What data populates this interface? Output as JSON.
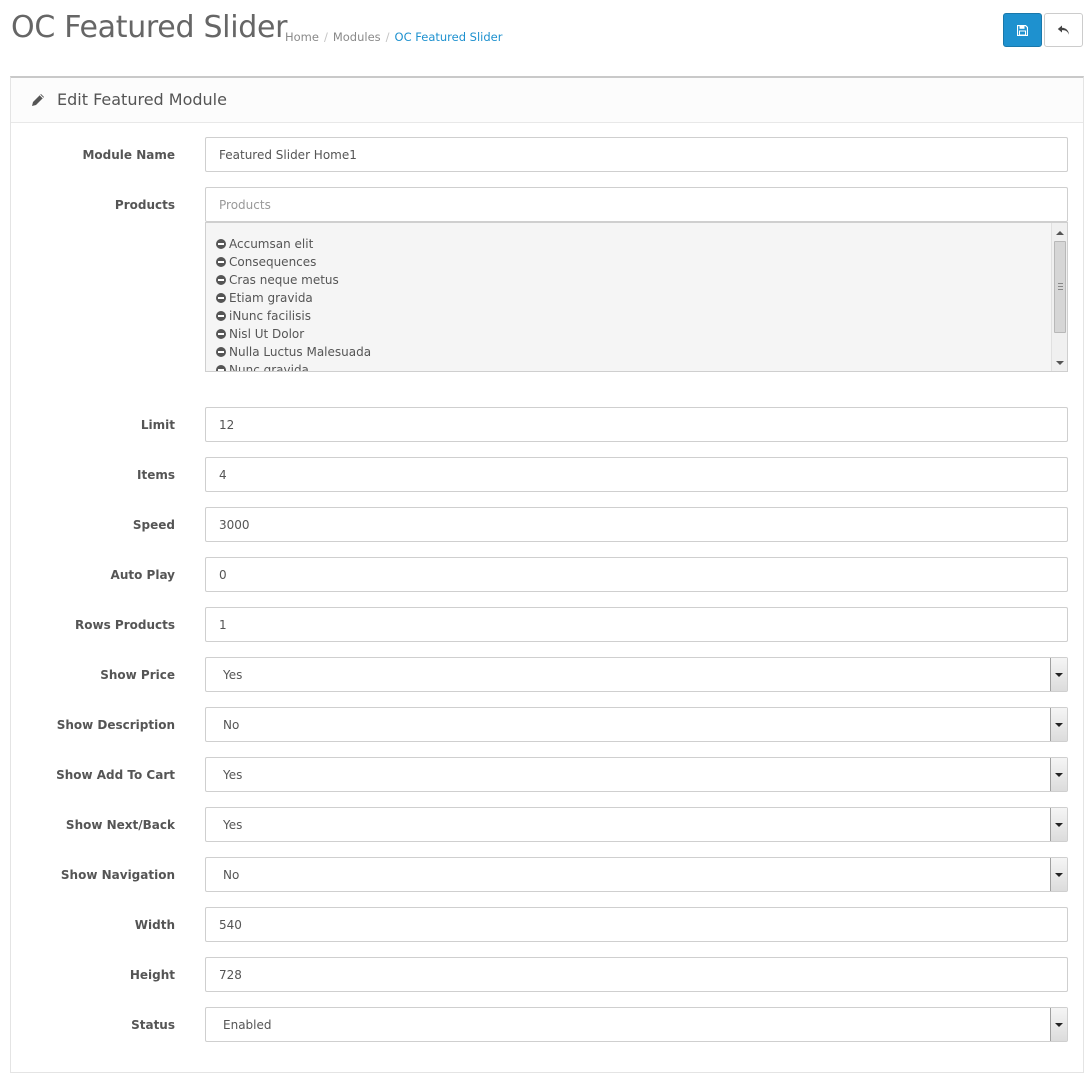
{
  "header": {
    "title": "OC Featured Slider",
    "breadcrumb": [
      "Home",
      "Modules",
      "OC Featured Slider"
    ],
    "save_icon": "save-icon",
    "back_icon": "reply-icon",
    "accent_color": "#1e91cf"
  },
  "panel": {
    "title": "Edit Featured Module",
    "title_icon": "pencil-icon"
  },
  "form": {
    "module_name": {
      "label": "Module Name",
      "value": "Featured Slider Home1"
    },
    "products": {
      "label": "Products",
      "placeholder": "Products",
      "items": [
        "Accumsan elit",
        "Consequences",
        "Cras neque metus",
        "Etiam gravida",
        "iNunc facilisis",
        "Nisl Ut Dolor",
        "Nulla Luctus Malesuada",
        "Nunc gravida"
      ]
    },
    "limit": {
      "label": "Limit",
      "value": "12"
    },
    "items": {
      "label": "Items",
      "value": "4"
    },
    "speed": {
      "label": "Speed",
      "value": "3000"
    },
    "auto_play": {
      "label": "Auto Play",
      "value": "0"
    },
    "rows_products": {
      "label": "Rows Products",
      "value": "1"
    },
    "show_price": {
      "label": "Show Price",
      "value": "Yes"
    },
    "show_description": {
      "label": "Show Description",
      "value": "No"
    },
    "show_add_to_cart": {
      "label": "Show Add To Cart",
      "value": "Yes"
    },
    "show_next_back": {
      "label": "Show Next/Back",
      "value": "Yes"
    },
    "show_navigation": {
      "label": "Show Navigation",
      "value": "No"
    },
    "width": {
      "label": "Width",
      "value": "540"
    },
    "height": {
      "label": "Height",
      "value": "728"
    },
    "status": {
      "label": "Status",
      "value": "Enabled"
    }
  }
}
